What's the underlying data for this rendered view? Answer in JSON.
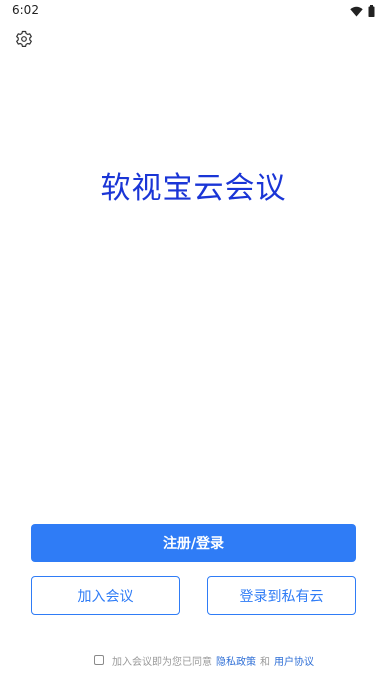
{
  "status_bar": {
    "time": "6:02",
    "icons": [
      "wifi-icon",
      "battery-icon"
    ]
  },
  "header": {
    "settings_icon": "gear-icon"
  },
  "main": {
    "app_title": "软视宝云会议"
  },
  "actions": {
    "register_login_label": "注册/登录",
    "join_meeting_label": "加入会议",
    "private_cloud_login_label": "登录到私有云"
  },
  "agreement": {
    "checked": false,
    "prefix_text": "加入会议即为您已同意",
    "privacy_policy_label": "隐私政策",
    "and_text": "和",
    "user_agreement_label": "用户协议"
  },
  "colors": {
    "title": "#1a35d6",
    "primary": "#2f7cf6",
    "link": "#2f6fd6",
    "muted_text": "#9a9a9a",
    "background": "#ffffff"
  }
}
